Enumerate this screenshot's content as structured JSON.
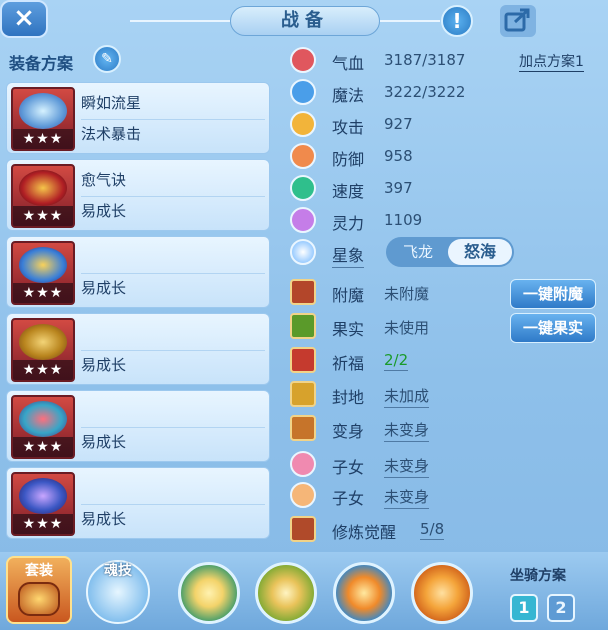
{
  "header": {
    "title": "战备",
    "info_icon_label": "!",
    "close_icon_label": "×"
  },
  "equipment": {
    "title": "装备方案",
    "slots": [
      {
        "name": "瞬如流星",
        "sub": "法术暴击",
        "stars": "★★★"
      },
      {
        "name": "愈气诀",
        "sub": "易成长",
        "stars": "★★★"
      },
      {
        "name": "",
        "sub": "易成长",
        "stars": "★★★"
      },
      {
        "name": "",
        "sub": "易成长",
        "stars": "★★★"
      },
      {
        "name": "",
        "sub": "易成长",
        "stars": "★★★"
      },
      {
        "name": "",
        "sub": "易成长",
        "stars": "★★★"
      }
    ]
  },
  "stats": {
    "plan_link": "加点方案1",
    "rows": [
      {
        "label": "气血",
        "value": "3187/3187",
        "color": "#e0575e"
      },
      {
        "label": "魔法",
        "value": "3222/3222",
        "color": "#4a9ee9"
      },
      {
        "label": "攻击",
        "value": "927",
        "color": "#f2b43a"
      },
      {
        "label": "防御",
        "value": "958",
        "color": "#f08a4c"
      },
      {
        "label": "速度",
        "value": "397",
        "color": "#2fbf8c"
      },
      {
        "label": "灵力",
        "value": "1109",
        "color": "#c57de8"
      }
    ],
    "xingxiang": {
      "label": "星象",
      "option_off": "飞龙",
      "option_on": "怒海"
    }
  },
  "enhance": {
    "rows": [
      {
        "label": "附魔",
        "value": "未附魔",
        "color": "#b3462a"
      },
      {
        "label": "果实",
        "value": "未使用",
        "color": "#5a9a2a"
      },
      {
        "label": "祈福",
        "value": "2/2",
        "color": "#c53a2e"
      },
      {
        "label": "封地",
        "value": "未加成",
        "color": "#d7a22c"
      },
      {
        "label": "变身",
        "value": "未变身",
        "color": "#c6742a"
      },
      {
        "label": "子女",
        "value": "未变身",
        "color": "#f08ab0"
      },
      {
        "label": "子女",
        "value": "未变身",
        "color": "#f5b678"
      },
      {
        "label": "修炼觉醒",
        "value": "5/8",
        "color": "#b04a2a"
      }
    ],
    "btn_enchant": "一键附魔",
    "btn_fruit": "一键果实"
  },
  "bottom": {
    "suit_label": "套装",
    "soul_label": "魂技",
    "skills": [
      {
        "name": "skill-1",
        "color": "#f3d36a"
      },
      {
        "name": "skill-2",
        "color": "#e9c35a"
      },
      {
        "name": "skill-3",
        "color": "#f08a2a"
      },
      {
        "name": "skill-4",
        "color": "#f4a43a"
      }
    ],
    "mount_title": "坐骑方案",
    "mount_buttons": [
      "1",
      "2"
    ]
  }
}
